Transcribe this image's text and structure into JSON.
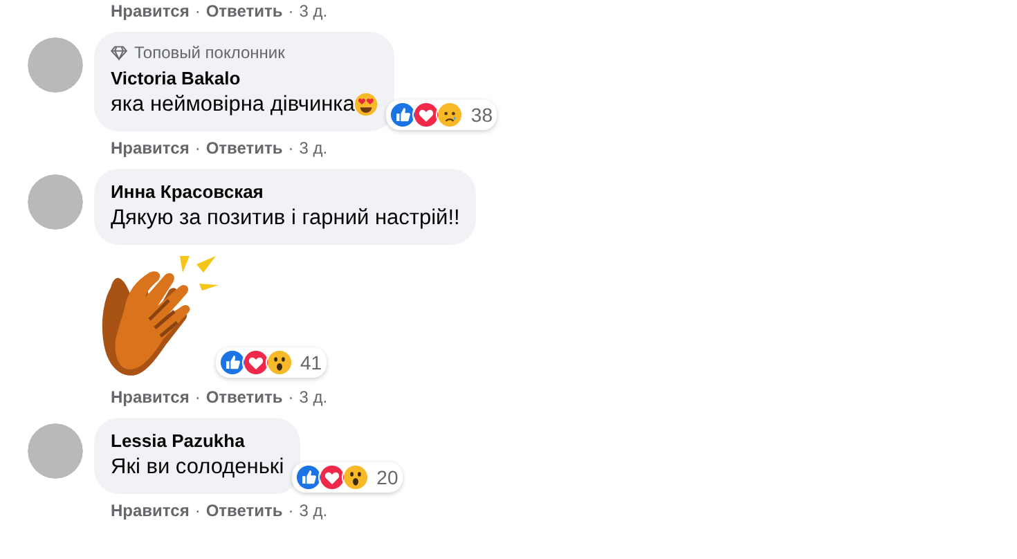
{
  "top_actions": {
    "like": "Нравится",
    "separator": "·",
    "reply": "Ответить",
    "separator_2": "·",
    "time": "3 д."
  },
  "comments": [
    {
      "badge": "Топовый поклонник",
      "author": "Victoria Bakalo",
      "text": "яка неймовірна дівчинка",
      "emoji_after_text": true,
      "reactions": [
        {
          "kind": "like"
        },
        {
          "kind": "love"
        },
        {
          "kind": "sad"
        }
      ],
      "reaction_count": "38",
      "actions": {
        "like": "Нравится",
        "separator": "·",
        "reply": "Ответить",
        "separator_2": "·",
        "time": "3 д."
      }
    },
    {
      "author": "Инна Красовская",
      "text": "Дякую за позитив і гарний настрій!!",
      "sticker": true,
      "reactions": [
        {
          "kind": "like"
        },
        {
          "kind": "love"
        },
        {
          "kind": "wow"
        }
      ],
      "reaction_count": "41",
      "actions": {
        "like": "Нравится",
        "separator": "·",
        "reply": "Ответить",
        "separator_2": "·",
        "time": "3 д."
      }
    },
    {
      "author": "Lessia Pazukha",
      "text": "Які ви солоденькі",
      "reactions": [
        {
          "kind": "like"
        },
        {
          "kind": "love"
        },
        {
          "kind": "wow"
        }
      ],
      "reaction_count": "20",
      "actions": {
        "like": "Нравится",
        "separator": "·",
        "reply": "Ответить",
        "separator_2": "·",
        "time": "3 д."
      }
    }
  ]
}
